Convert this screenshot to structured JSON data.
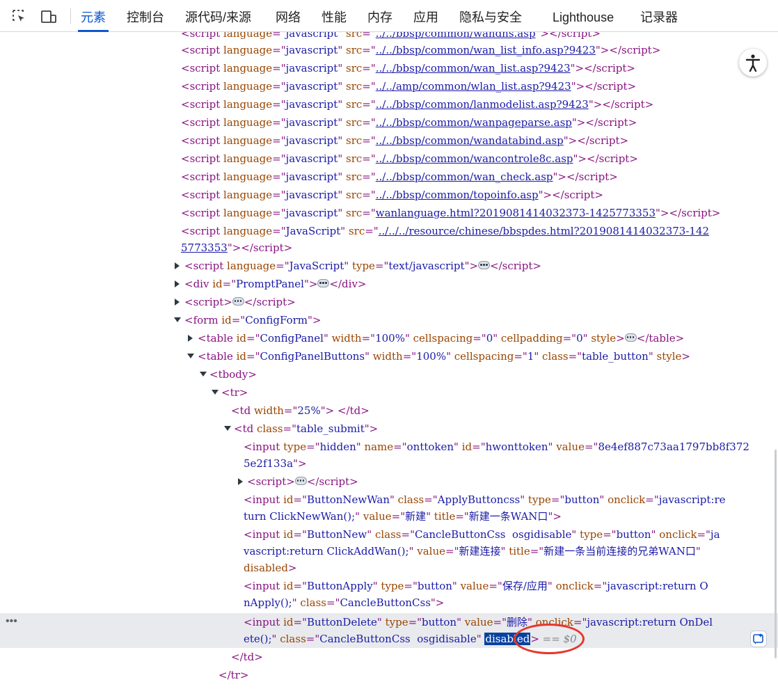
{
  "toolbar": {
    "inspect_icon": "inspect-element-icon",
    "device_icon": "device-toolbar-icon",
    "tabs": [
      {
        "label": "元素"
      },
      {
        "label": "控制台"
      },
      {
        "label": "源代码/来源"
      },
      {
        "label": "网络"
      },
      {
        "label": "性能"
      },
      {
        "label": "内存"
      },
      {
        "label": "应用"
      },
      {
        "label": "隐私与安全"
      },
      {
        "label": "Lighthouse"
      },
      {
        "label": "记录器"
      }
    ],
    "active_tab": "元素"
  },
  "colors": {
    "active_tab": "#0b57d0",
    "tag": "#881280",
    "attr_name": "#994500",
    "attr_value": "#1a1aa6",
    "selection": "#0842a0",
    "highlight_circle": "#e8362b"
  },
  "tree": {
    "script_srcs": [
      "../../bbsp/common/wandns.asp",
      "../../bbsp/common/wan_list_info.asp?9423",
      "../../bbsp/common/wan_list.asp?9423",
      "../../amp/common/wlan_list.asp?9423",
      "../../bbsp/common/lanmodelist.asp?9423",
      "../../bbsp/common/wanpageparse.asp",
      "../../bbsp/common/wandatabind.asp",
      "../../bbsp/common/wancontrole8c.asp",
      "../../bbsp/common/wan_check.asp",
      "../../bbsp/common/topoinfo.asp",
      "wanlanguage.html?2019081414032373-1425773353"
    ],
    "res_src_part1": "../../../resource/chinese/bbspdes.html?2019081414032373-142",
    "res_src_part2": "5773353",
    "prompt_panel_id": "PromptPanel",
    "form_id": "ConfigForm",
    "config_panel": {
      "id": "ConfigPanel",
      "width": "100%",
      "cellspacing": "0",
      "cellpadding": "0"
    },
    "config_panel_buttons": {
      "id": "ConfigPanelButtons",
      "width": "100%",
      "cellspacing": "1",
      "class": "table_button"
    },
    "td_width": "25%",
    "td_class": "table_submit",
    "hidden_input": {
      "type": "hidden",
      "name": "onttoken",
      "id": "hwonttoken",
      "value_part1": "8e4ef887c73aa1797bb8f372",
      "value_part2": "5e2f133a"
    },
    "btn_new_wan": {
      "id": "ButtonNewWan",
      "class": "ApplyButtoncss",
      "onclick_part1": "javascript:re",
      "onclick_part2": "turn ClickNewWan();",
      "value": "新建",
      "title": "新建一条WAN口"
    },
    "btn_new": {
      "id": "ButtonNew",
      "class": "CancleButtonCss  osgidisable",
      "onclick_part1": "ja",
      "onclick_part2": "vascript:return ClickAddWan();",
      "value": "新建连接",
      "title": "新建一条当前连接的兄弟WAN口",
      "flag": "disabled"
    },
    "btn_apply": {
      "id": "ButtonApply",
      "value": "保存/应用",
      "onclick_part1": "javascript:return O",
      "onclick_part2": "nApply();",
      "class": "CancleButtonCss"
    },
    "btn_delete": {
      "id": "ButtonDelete",
      "value": "删除",
      "onclick_part1": "javascript:return OnDel",
      "onclick_part2": "ete();",
      "class": "CancleButtonCss  osgidisable",
      "flag": "disabled",
      "console_ref": "== $0"
    }
  }
}
